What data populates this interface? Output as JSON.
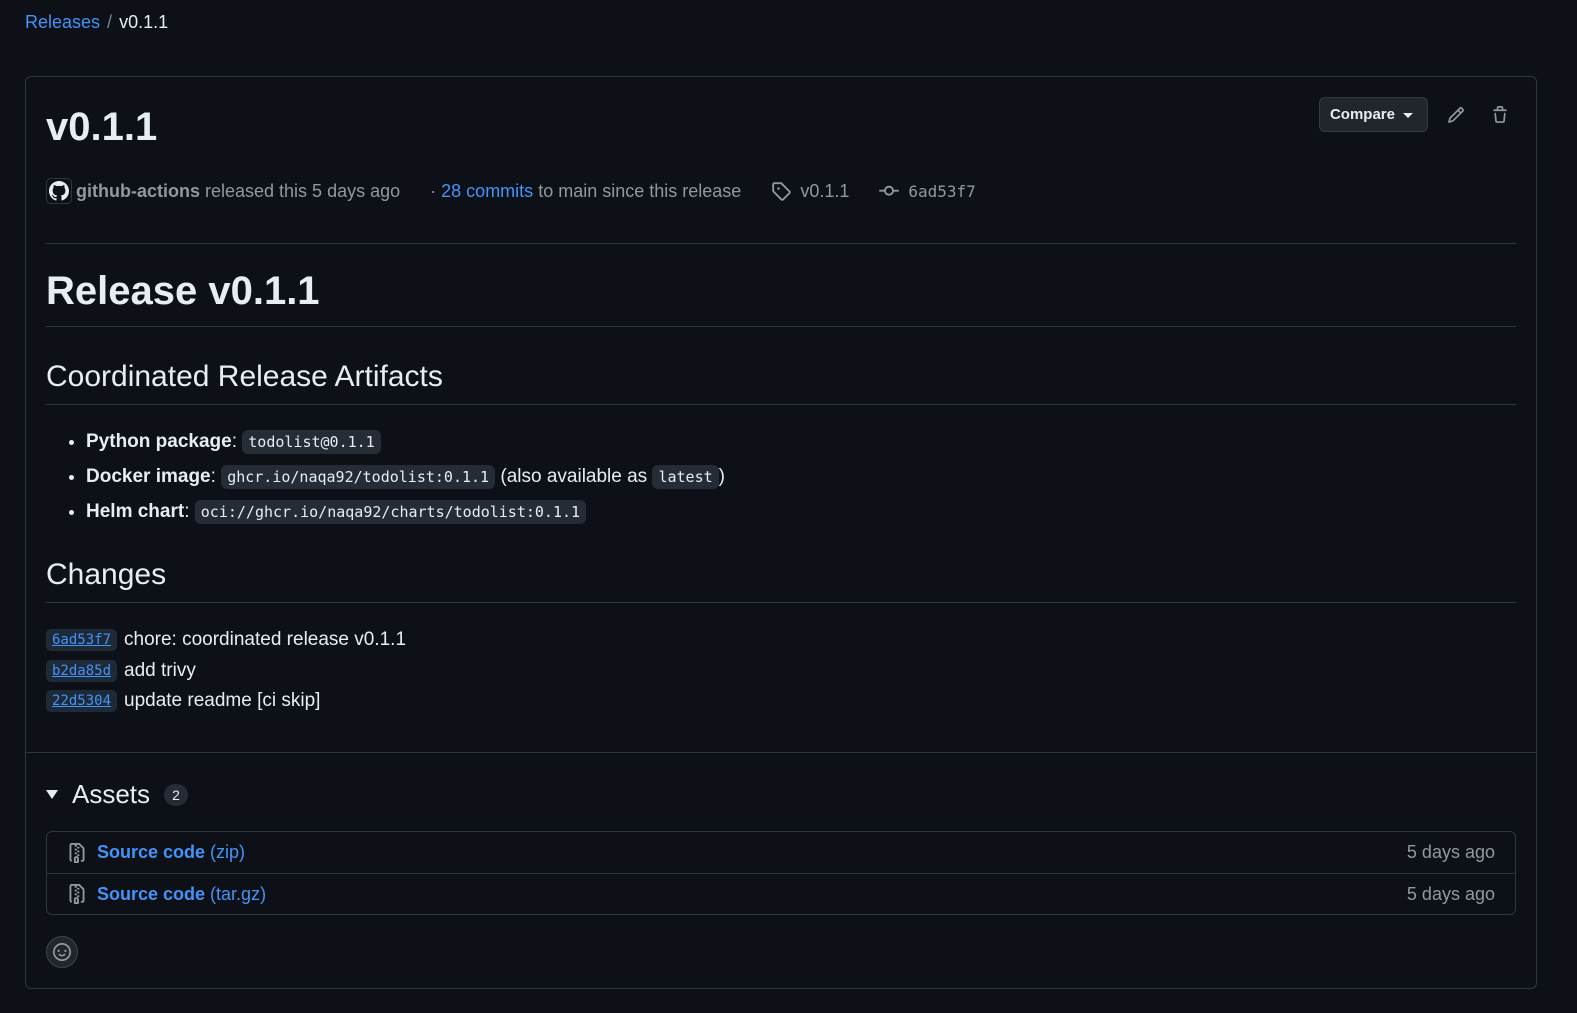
{
  "breadcrumb": {
    "parent": "Releases",
    "separator": "/",
    "current": "v0.1.1"
  },
  "release": {
    "title": "v0.1.1",
    "compare_label": "Compare",
    "author": "github-actions",
    "released_text": "released this 5 days ago",
    "commits_prefix": "·",
    "commits_link": "28 commits",
    "commits_suffix": "to main since this release",
    "tag": "v0.1.1",
    "commit_sha": "6ad53f7"
  },
  "body": {
    "h1": "Release v0.1.1",
    "artifacts_heading": "Coordinated Release Artifacts",
    "artifacts": [
      {
        "label": "Python package",
        "colon": ":",
        "code": "todolist@0.1.1",
        "extra_pre": "",
        "extra_code": "",
        "extra_post": ""
      },
      {
        "label": "Docker image",
        "colon": ":",
        "code": "ghcr.io/naqa92/todolist:0.1.1",
        "extra_pre": "(also available as",
        "extra_code": "latest",
        "extra_post": ")"
      },
      {
        "label": "Helm chart",
        "colon": ":",
        "code": "oci://ghcr.io/naqa92/charts/todolist:0.1.1",
        "extra_pre": "",
        "extra_code": "",
        "extra_post": ""
      }
    ],
    "changes_heading": "Changes",
    "changes": [
      {
        "sha": "6ad53f7",
        "message": "chore: coordinated release v0.1.1"
      },
      {
        "sha": "b2da85d",
        "message": "add trivy"
      },
      {
        "sha": "22d5304",
        "message": "update readme [ci skip]"
      }
    ]
  },
  "assets": {
    "label": "Assets",
    "count": "2",
    "items": [
      {
        "name": "Source code",
        "ext": "(zip)",
        "date": "5 days ago"
      },
      {
        "name": "Source code",
        "ext": "(tar.gz)",
        "date": "5 days ago"
      }
    ]
  },
  "icons": {
    "compare_caret": "triangle-down-icon",
    "edit": "pencil-icon",
    "delete": "trash-icon",
    "avatar": "github-mark-icon",
    "tag": "tag-icon",
    "commit": "git-commit-icon",
    "file_zip": "file-zip-icon",
    "reaction": "smiley-icon"
  },
  "colors": {
    "background": "#0d1117",
    "border": "#30363d",
    "link": "#4493f8",
    "muted": "#9198a1",
    "text": "#e6edf3"
  }
}
